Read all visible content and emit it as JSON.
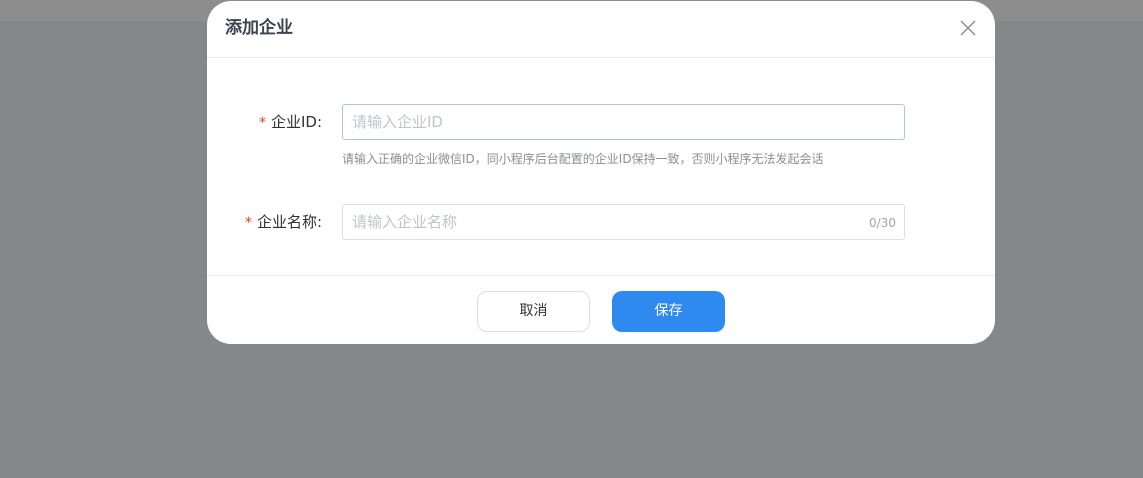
{
  "dialog": {
    "title": "添加企业",
    "close_icon": "close-icon"
  },
  "form": {
    "enterprise_id": {
      "label": "企业ID:",
      "required": true,
      "value": "",
      "placeholder": "请输入企业ID",
      "hint": "请输入正确的企业微信ID，同小程序后台配置的企业ID保持一致，否则小程序无法发起会话"
    },
    "enterprise_name": {
      "label": "企业名称:",
      "required": true,
      "value": "",
      "placeholder": "请输入企业名称",
      "counter": "0/30"
    }
  },
  "footer": {
    "cancel_label": "取消",
    "save_label": "保存"
  },
  "colors": {
    "primary": "#2f8af0",
    "required": "#e6432a",
    "overlay": "#86878b"
  }
}
